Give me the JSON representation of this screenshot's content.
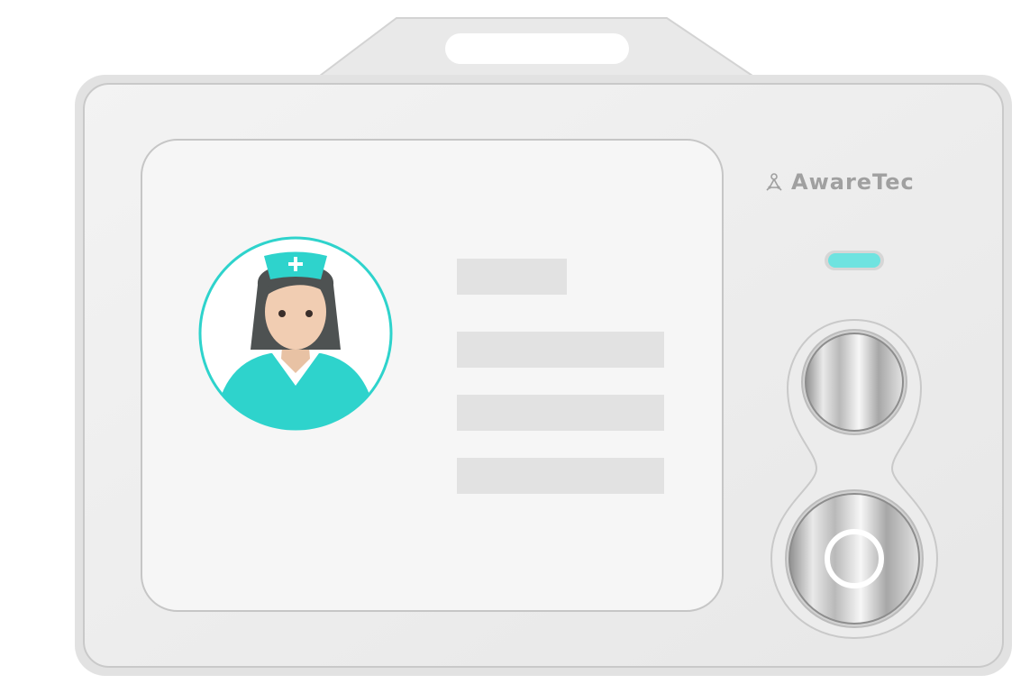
{
  "brand": {
    "name": "AwareTec",
    "icon": "aware-logo-icon",
    "color": "#a0a0a0"
  },
  "colors": {
    "badge_body": "#efefef",
    "badge_border": "#c8c8c8",
    "screen": "#f6f6f6",
    "accent_teal": "#2ed3cc",
    "indicator_led": "#6fe3e0",
    "placeholder_bar": "#e2e2e2"
  },
  "avatar": {
    "role": "nurse",
    "icon": "nurse-avatar-icon"
  },
  "indicator": {
    "icon": "status-led-icon"
  },
  "buttons": {
    "top": {
      "icon": "top-button-icon"
    },
    "bottom": {
      "icon": "power-ring-icon"
    }
  }
}
